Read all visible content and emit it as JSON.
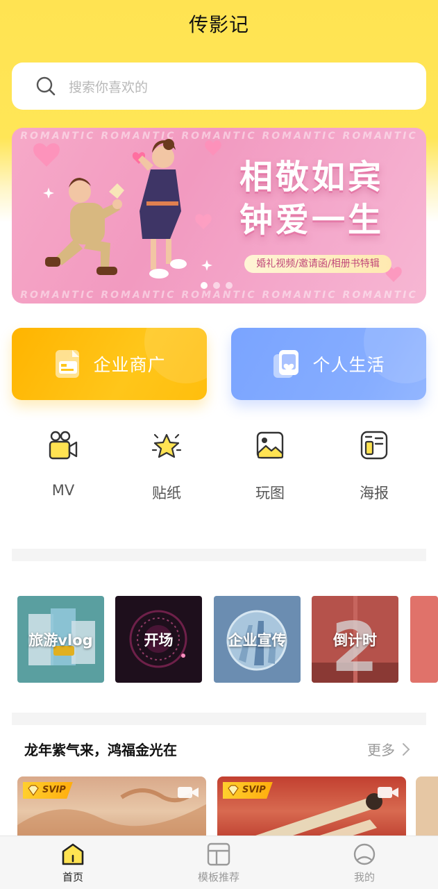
{
  "app": {
    "title": "传影记"
  },
  "search": {
    "placeholder": "搜索你喜欢的"
  },
  "banner": {
    "watermark": "ROMANTIC ROMANTIC ROMANTIC ROMANTIC ROMANTIC",
    "headline_line1": "相敬如宾",
    "headline_line2": "钟爱一生",
    "tagline": "婚礼视频/邀请函/相册书特辑",
    "dots": 3,
    "active_dot": 0
  },
  "categories": [
    {
      "label": "企业商广",
      "icon": "document-icon",
      "color": "#ffb400"
    },
    {
      "label": "个人生活",
      "icon": "photo-card-icon",
      "color": "#7aa4ff"
    }
  ],
  "tools": [
    {
      "label": "MV",
      "icon": "video-camera-icon"
    },
    {
      "label": "贴纸",
      "icon": "star-sparkle-icon"
    },
    {
      "label": "玩图",
      "icon": "image-icon"
    },
    {
      "label": "海报",
      "icon": "poster-icon"
    }
  ],
  "themes": [
    {
      "label": "旅游vlog",
      "color": "#5a9fa0"
    },
    {
      "label": "开场",
      "color": "#1e0f1c"
    },
    {
      "label": "企业宣传",
      "color": "#6b8db1"
    },
    {
      "label": "倒计时",
      "color": "#b5524b"
    }
  ],
  "section": {
    "title": "龙年紫气来，鸿福金光在",
    "more_label": "更多"
  },
  "template_cards": [
    {
      "badge": "SVIP"
    },
    {
      "badge": "SVIP"
    }
  ],
  "tabbar": {
    "items": [
      {
        "label": "首页",
        "icon": "home-icon",
        "active": true
      },
      {
        "label": "模板推荐",
        "icon": "template-icon",
        "active": false
      },
      {
        "label": "我的",
        "icon": "profile-icon",
        "active": false
      }
    ]
  },
  "colors": {
    "accent_yellow": "#ffe352",
    "active_tab": "#222222",
    "inactive_tab": "#999999"
  }
}
